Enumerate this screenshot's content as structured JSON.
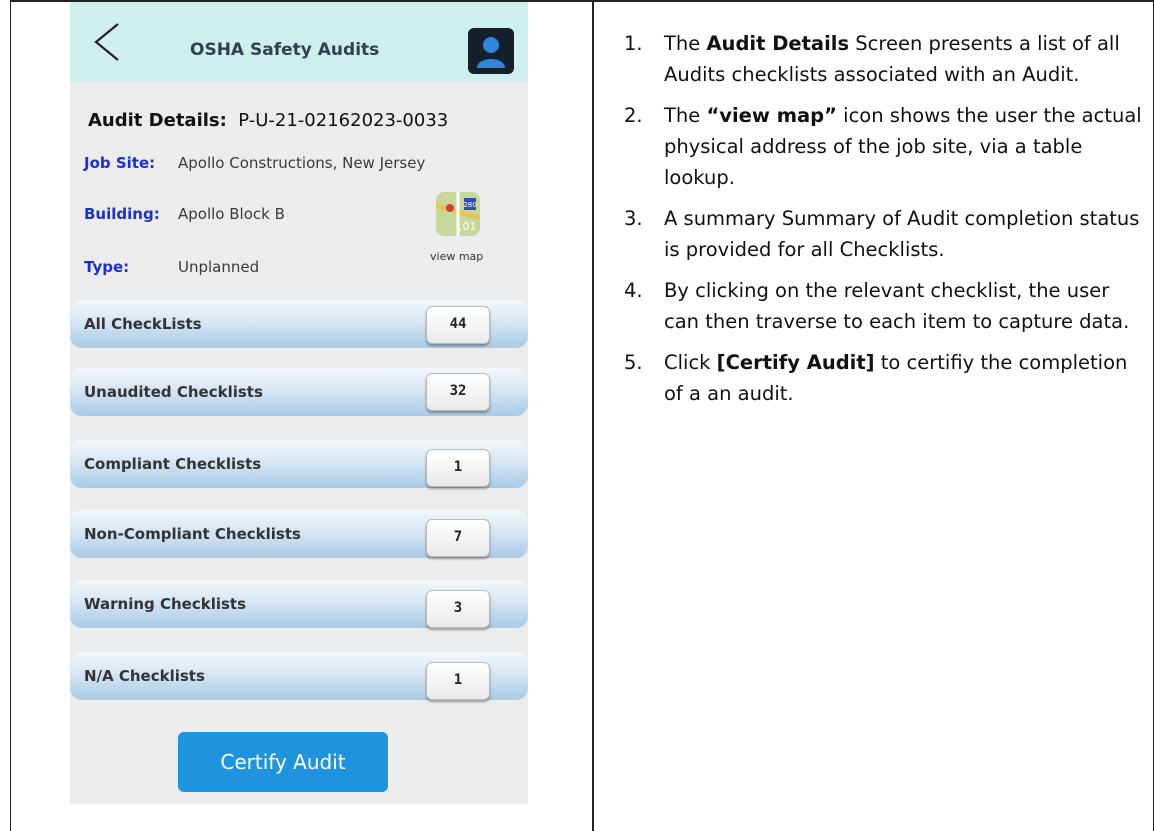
{
  "app": {
    "title": "OSHA Safety Audits",
    "accent_color": "#cfeeee",
    "primary_button_color": "#1e94de",
    "label_color": "#1a2fd6"
  },
  "audit": {
    "details_label": "Audit Details:",
    "id": "P-U-21-02162023-0033",
    "fields": [
      {
        "label": "Job Site:",
        "value": "Apollo Constructions, New Jersey"
      },
      {
        "label": "Building:",
        "value": "Apollo Block B"
      },
      {
        "label": "Type:",
        "value": "Unplanned"
      }
    ],
    "map_link": "view map",
    "map_badge": "280",
    "map_route": "101"
  },
  "checklists": [
    {
      "label": "All CheckLists",
      "count": "44"
    },
    {
      "label": "Unaudited Checklists",
      "count": "32"
    },
    {
      "label": "Compliant Checklists",
      "count": "1"
    },
    {
      "label": "Non-Compliant Checklists",
      "count": "7"
    },
    {
      "label": "Warning Checklists",
      "count": "3"
    },
    {
      "label": "N/A Checklists",
      "count": "1"
    }
  ],
  "certify_button": "Certify Audit",
  "icons": [
    "back-chevron-icon",
    "profile-icon",
    "map-icon"
  ],
  "instructions": [
    {
      "num": "1.",
      "pre": "The ",
      "bold": "Audit Details",
      "post": " Screen presents a list of all Audits checklists associated with an Audit."
    },
    {
      "num": "2.",
      "pre": "The ",
      "bold": "“view map”",
      "post": " icon shows the user the actual physical address of the job site, via a table lookup."
    },
    {
      "num": "3.",
      "pre": "A summary Summary of  Audit completion status is provided for all Checklists.",
      "bold": "",
      "post": ""
    },
    {
      "num": "4.",
      "pre": "By clicking on the relevant checklist, the user can then traverse to each item to capture data.",
      "bold": "",
      "post": ""
    },
    {
      "num": "5.",
      "pre": "Click ",
      "bold": "[Certify Audit]",
      "post": " to certifiy the completion of a an audit."
    }
  ]
}
